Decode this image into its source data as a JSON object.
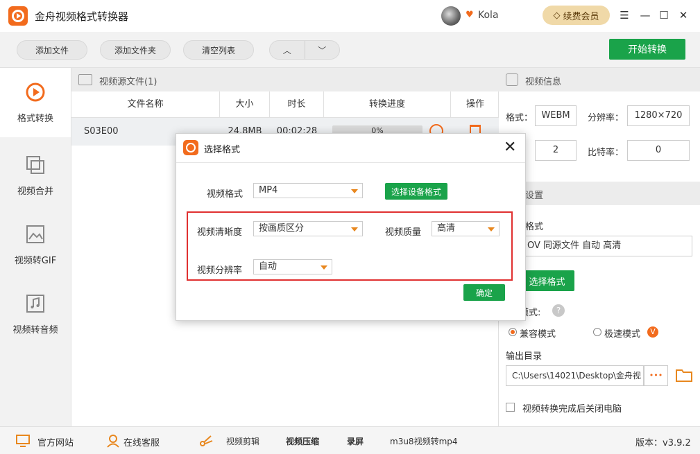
{
  "app": {
    "title": "金舟视频格式转换器",
    "username": "Kola",
    "vip_label": "续费会员",
    "window_controls": [
      "menu-icon",
      "minimize-icon",
      "maximize-icon",
      "close-icon"
    ]
  },
  "toolbar": {
    "add_file": "添加文件",
    "add_folder": "添加文件夹",
    "clear_list": "清空列表",
    "start_convert": "开始转换"
  },
  "sidebar": {
    "items": [
      {
        "label": "格式转换",
        "icon": "convert-icon",
        "active": true
      },
      {
        "label": "视频合并",
        "icon": "merge-icon",
        "active": false
      },
      {
        "label": "视频转GIF",
        "icon": "gif-icon",
        "active": false
      },
      {
        "label": "视频转音频",
        "icon": "audio-icon",
        "active": false
      }
    ]
  },
  "source": {
    "header": "视频源文件(1)",
    "columns": [
      "文件名称",
      "大小",
      "时长",
      "转换进度",
      "操作"
    ],
    "rows": [
      {
        "name": "S03E00",
        "size": "24.8MB",
        "duration": "00:02:28",
        "progress": "0%"
      }
    ]
  },
  "video_info": {
    "header": "视频信息",
    "format_label": "格式：",
    "format_value": "WEBM",
    "resolution_label": "分辨率：",
    "resolution_value": "1280×720",
    "fps_value": "2",
    "bitrate_label": "比特率：",
    "bitrate_value": "0"
  },
  "output_settings": {
    "header": "设置",
    "format_label": "格式",
    "format_summary": "OV 同源文件 自动 高清",
    "choose_format_btn": "选择格式",
    "mode_label": "模式:",
    "mode_compat": "兼容模式",
    "mode_fast": "极速模式",
    "output_dir_label": "输出目录",
    "output_dir_value": "C:\\Users\\14021\\Desktop\\金舟视",
    "more_btn": "•••",
    "shutdown_label": "视频转换完成后关闭电脑"
  },
  "bottombar": {
    "website": "官方网站",
    "support": "在线客服",
    "video_edit": "视频剪辑",
    "video_compress": "视频压缩",
    "record": "录屏",
    "m3u8": "m3u8视频转mp4",
    "version": "版本：v3.9.2"
  },
  "dialog": {
    "title": "选择格式",
    "video_format_label": "视频格式",
    "video_format_value": "MP4",
    "device_format_btn": "选择设备格式",
    "clarity_label": "视频清晰度",
    "clarity_value": "按画质区分",
    "quality_label": "视频质量",
    "quality_value": "高清",
    "resolution_label": "视频分辨率",
    "resolution_value": "自动",
    "confirm_btn": "确定"
  },
  "colors": {
    "accent_orange": "#f26b1d",
    "brand_green": "#1aa34a",
    "highlight_red": "#e03030"
  }
}
